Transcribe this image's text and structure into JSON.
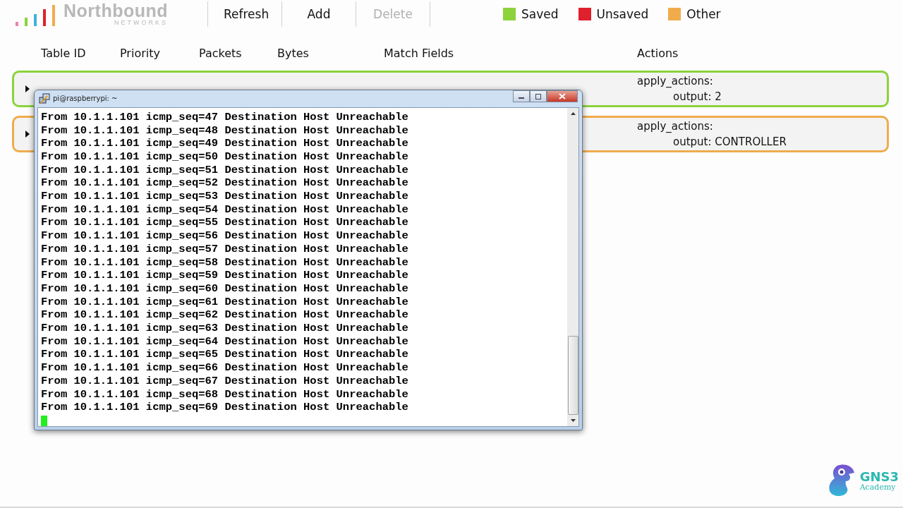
{
  "logo": {
    "name": "Northbound",
    "tagline": "NETWORKS"
  },
  "toolbar": [
    {
      "label": "Refresh",
      "disabled": false
    },
    {
      "label": "Add",
      "disabled": false
    },
    {
      "label": "Delete",
      "disabled": true
    }
  ],
  "legend": [
    {
      "label": "Saved",
      "color": "#8cd23c"
    },
    {
      "label": "Unsaved",
      "color": "#e0202c"
    },
    {
      "label": "Other",
      "color": "#f0ac4c"
    }
  ],
  "table": {
    "columns": [
      "Table ID",
      "Priority",
      "Packets",
      "Bytes",
      "Match Fields",
      "Actions"
    ],
    "rows": [
      {
        "color": "#8cd23c",
        "expanded": false,
        "actions": [
          "apply_actions:",
          "output: 2"
        ]
      },
      {
        "color": "#f0ac4c",
        "expanded": false,
        "actions": [
          "apply_actions:",
          "output: CONTROLLER"
        ]
      }
    ]
  },
  "terminal": {
    "title": "pi@raspberrypi: ~",
    "lines": [
      "From 10.1.1.101 icmp_seq=47 Destination Host Unreachable",
      "From 10.1.1.101 icmp_seq=48 Destination Host Unreachable",
      "From 10.1.1.101 icmp_seq=49 Destination Host Unreachable",
      "From 10.1.1.101 icmp_seq=50 Destination Host Unreachable",
      "From 10.1.1.101 icmp_seq=51 Destination Host Unreachable",
      "From 10.1.1.101 icmp_seq=52 Destination Host Unreachable",
      "From 10.1.1.101 icmp_seq=53 Destination Host Unreachable",
      "From 10.1.1.101 icmp_seq=54 Destination Host Unreachable",
      "From 10.1.1.101 icmp_seq=55 Destination Host Unreachable",
      "From 10.1.1.101 icmp_seq=56 Destination Host Unreachable",
      "From 10.1.1.101 icmp_seq=57 Destination Host Unreachable",
      "From 10.1.1.101 icmp_seq=58 Destination Host Unreachable",
      "From 10.1.1.101 icmp_seq=59 Destination Host Unreachable",
      "From 10.1.1.101 icmp_seq=60 Destination Host Unreachable",
      "From 10.1.1.101 icmp_seq=61 Destination Host Unreachable",
      "From 10.1.1.101 icmp_seq=62 Destination Host Unreachable",
      "From 10.1.1.101 icmp_seq=63 Destination Host Unreachable",
      "From 10.1.1.101 icmp_seq=64 Destination Host Unreachable",
      "From 10.1.1.101 icmp_seq=65 Destination Host Unreachable",
      "From 10.1.1.101 icmp_seq=66 Destination Host Unreachable",
      "From 10.1.1.101 icmp_seq=67 Destination Host Unreachable",
      "From 10.1.1.101 icmp_seq=68 Destination Host Unreachable",
      "From 10.1.1.101 icmp_seq=69 Destination Host Unreachable"
    ]
  },
  "brand": {
    "name": "GNS3",
    "sub": "Academy"
  }
}
